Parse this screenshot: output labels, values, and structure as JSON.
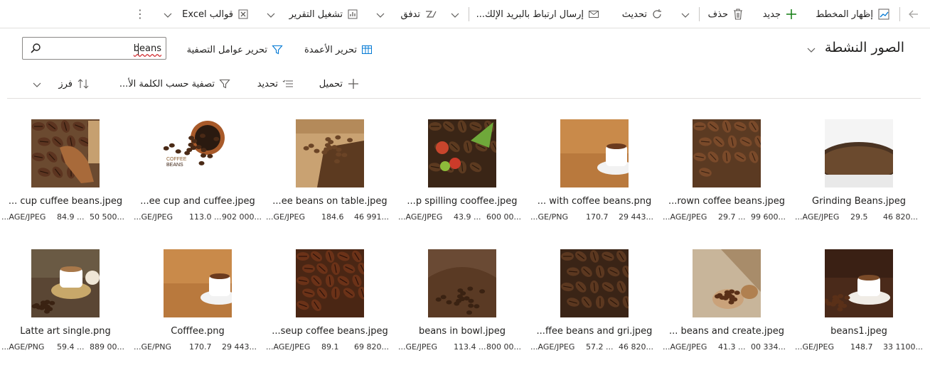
{
  "command_bar": {
    "show_chart": "إظهار المخطط",
    "new": "جديد",
    "delete": "حذف",
    "refresh": "تحديث",
    "email_link": "إرسال ارتباط بالبريد الإلك...",
    "run_report": "تشغيل التقرير",
    "flow": "تدفق",
    "excel_templates": "قوالب Excel"
  },
  "view": {
    "title": "الصور النشطة"
  },
  "toolbar": {
    "edit_columns": "تحرير الأعمدة",
    "edit_filters": "تحرير عوامل التصفية"
  },
  "search": {
    "value": "beans"
  },
  "grid_toolbar": {
    "upload": "تحميل",
    "select": "تحديد",
    "filter_keyword": "تصفية حسب الكلمة الأ...",
    "sort": "فرز"
  },
  "tiles": [
    {
      "name": "Grinding Beans.jpeg",
      "type": "...AGE/JPEG",
      "size": "29.5",
      "dim": "46 820..."
    },
    {
      "name": "...rown coffee beans.jpeg",
      "type": "...AGE/JPEG",
      "size": "29.7 ...",
      "dim": "99 600..."
    },
    {
      "name": "... with coffee beans.png",
      "type": "...GE/PNG",
      "size": "170.7",
      "dim": "29 443..."
    },
    {
      "name": "...p spilling cooffee.jpeg",
      "type": "...AGE/JPEG",
      "size": "43.9 ...",
      "dim": "600 00..."
    },
    {
      "name": "...ee beans on table.jpeg",
      "type": "...GE/JPEG",
      "size": "184.6",
      "dim": "46 991..."
    },
    {
      "name": "...ee cup and cuffee.jpeg",
      "type": "...GE/JPEG",
      "size": "113.0 ...",
      "dim": "902 000..."
    },
    {
      "name": "... cup cuffee beans.jpeg",
      "type": "...AGE/JPEG",
      "size": "84.9 ...",
      "dim": "50 500..."
    },
    {
      "name": "beans1.jpeg",
      "type": "...GE/JPEG",
      "size": "148.7",
      "dim": "33 1100..."
    },
    {
      "name": "... beans and create.jpeg",
      "type": "...AGE/JPEG",
      "size": "41.3 ...",
      "dim": "00 334..."
    },
    {
      "name": "...ffee beans and gri.jpeg",
      "type": "...AGE/JPEG",
      "size": "57.2 ...",
      "dim": "46 820..."
    },
    {
      "name": "beans in bowl.jpeg",
      "type": "...GE/JPEG",
      "size": "113.4 ...",
      "dim": "800 00..."
    },
    {
      "name": "...seup coffee beans.jpeg",
      "type": "...AGE/JPEG",
      "size": "89.1",
      "dim": "69 820..."
    },
    {
      "name": "Cofffee.png",
      "type": "...GE/PNG",
      "size": "170.7",
      "dim": "29 443..."
    },
    {
      "name": "Latte art single.png",
      "type": "...AGE/PNG",
      "size": "59.4 ...",
      "dim": "889 00..."
    }
  ],
  "colors": {
    "accent": "#0078d4",
    "new_plus": "#107c10",
    "border": "#e1dfdd"
  }
}
